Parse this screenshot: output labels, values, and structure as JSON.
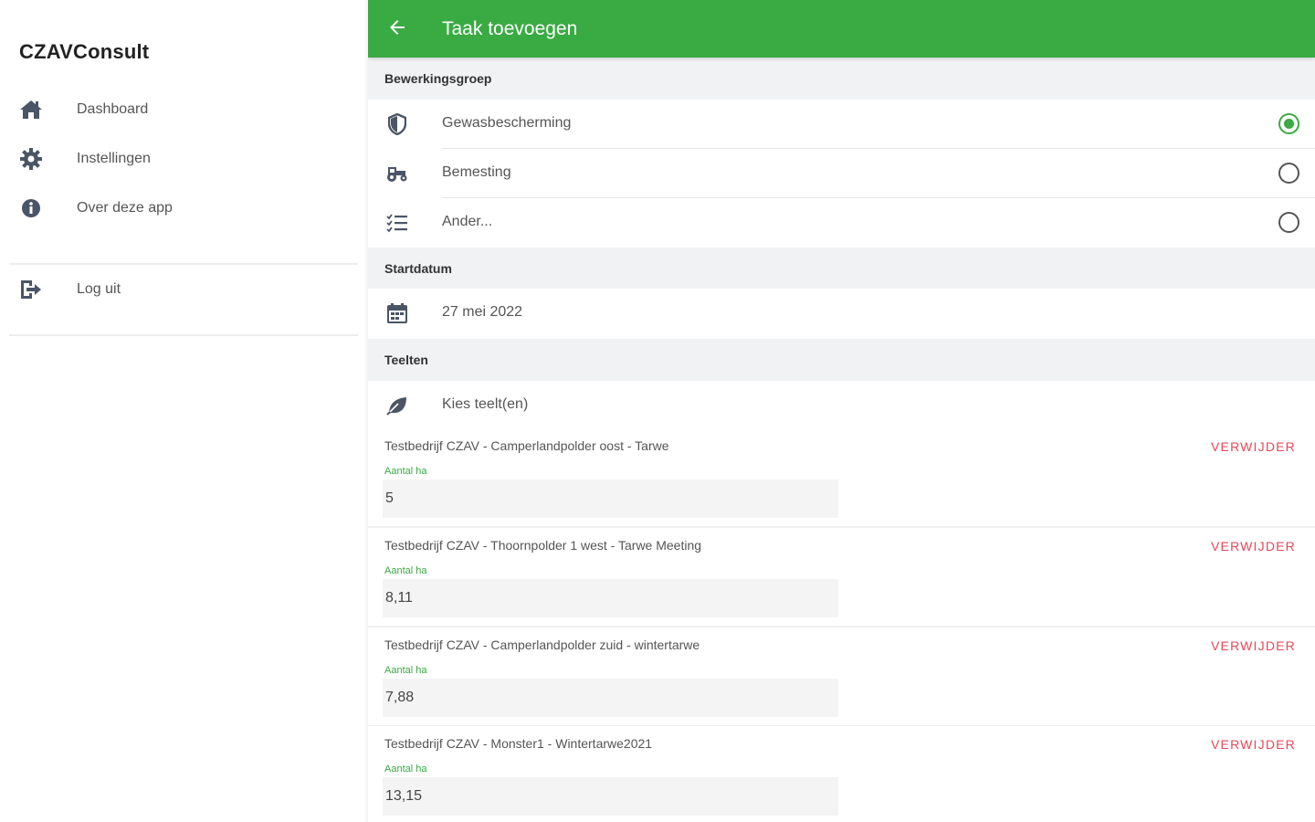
{
  "sidebar": {
    "app_title": "CZAVConsult",
    "items": [
      {
        "label": "Dashboard",
        "icon": "home-icon"
      },
      {
        "label": "Instellingen",
        "icon": "gear-icon"
      },
      {
        "label": "Over deze app",
        "icon": "info-icon"
      }
    ],
    "logout": {
      "label": "Log uit",
      "icon": "logout-icon"
    }
  },
  "appbar": {
    "title": "Taak toevoegen",
    "back_icon": "arrow-left-icon"
  },
  "colors": {
    "accent": "#3aaa43",
    "danger": "#e5495a",
    "section_bg": "#f1f2f4"
  },
  "bewerkingsgroep": {
    "header": "Bewerkingsgroep",
    "options": [
      {
        "label": "Gewasbescherming",
        "icon": "shield-icon",
        "selected": true
      },
      {
        "label": "Bemesting",
        "icon": "tractor-icon",
        "selected": false
      },
      {
        "label": "Ander...",
        "icon": "list-check-icon",
        "selected": false
      }
    ]
  },
  "startdatum": {
    "header": "Startdatum",
    "value": "27 mei 2022",
    "icon": "calendar-icon"
  },
  "teelten": {
    "header": "Teelten",
    "choose_label": "Kies teelt(en)",
    "choose_icon": "leaf-icon",
    "field_label": "Aantal ha",
    "remove_label": "VERWIJDER",
    "items": [
      {
        "title": "Testbedrijf CZAV - Camperlandpolder oost - Tarwe",
        "ha": "5"
      },
      {
        "title": "Testbedrijf CZAV - Thoornpolder 1 west - Tarwe Meeting",
        "ha": "8,11"
      },
      {
        "title": "Testbedrijf CZAV - Camperlandpolder zuid - wintertarwe",
        "ha": "7,88"
      },
      {
        "title": "Testbedrijf CZAV - Monster1 - Wintertarwe2021",
        "ha": "13,15"
      }
    ]
  }
}
